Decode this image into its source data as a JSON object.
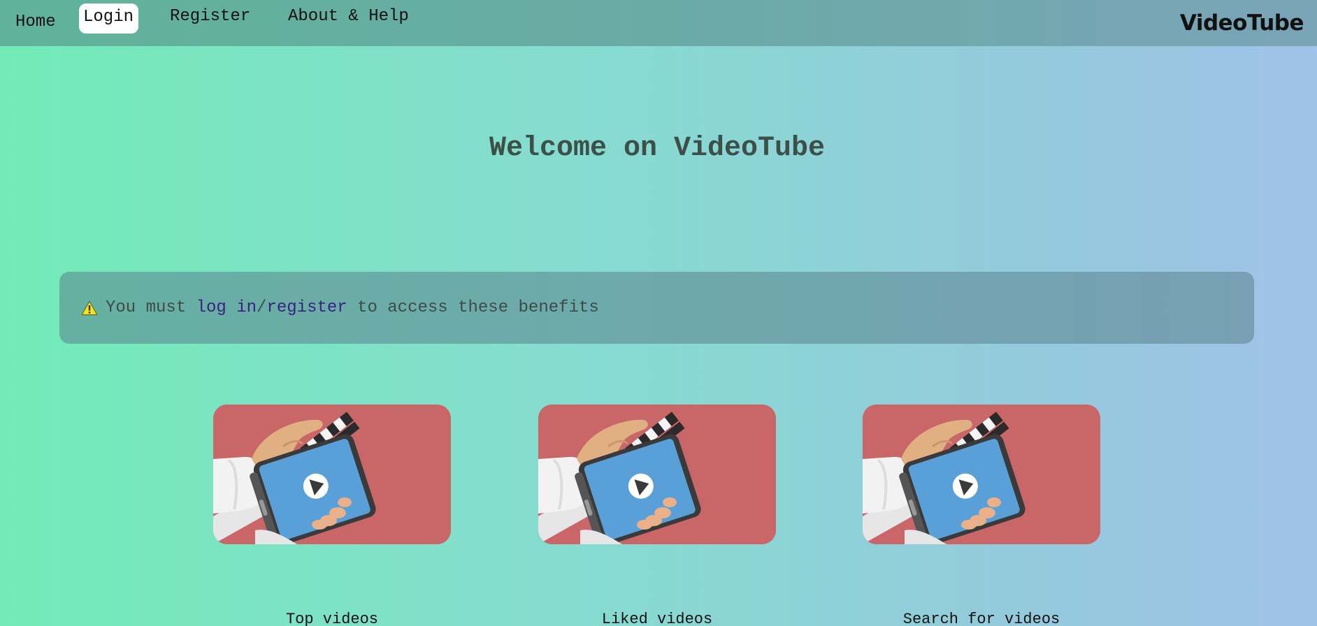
{
  "nav": {
    "home": "Home",
    "login": "Login",
    "register": "Register",
    "about": "About & Help",
    "brand": "VideoTube"
  },
  "main": {
    "welcome": "Welcome on VideoTube"
  },
  "alert": {
    "icon": "warning-icon",
    "prefix": "You must ",
    "login_link": "log in",
    "separator": "/",
    "register_link": "register",
    "suffix": " to access these benefits"
  },
  "cards": [
    {
      "label": "Top videos",
      "image": "video-clapper-phone-illustration"
    },
    {
      "label": "Liked videos",
      "image": "video-clapper-phone-illustration"
    },
    {
      "label": "Search for videos",
      "image": "video-clapper-phone-illustration"
    }
  ],
  "colors": {
    "nav_bar": "#6aaba6",
    "card_bg": "#c96668",
    "link": "#3c1f86",
    "heading": "#3c4f48"
  }
}
